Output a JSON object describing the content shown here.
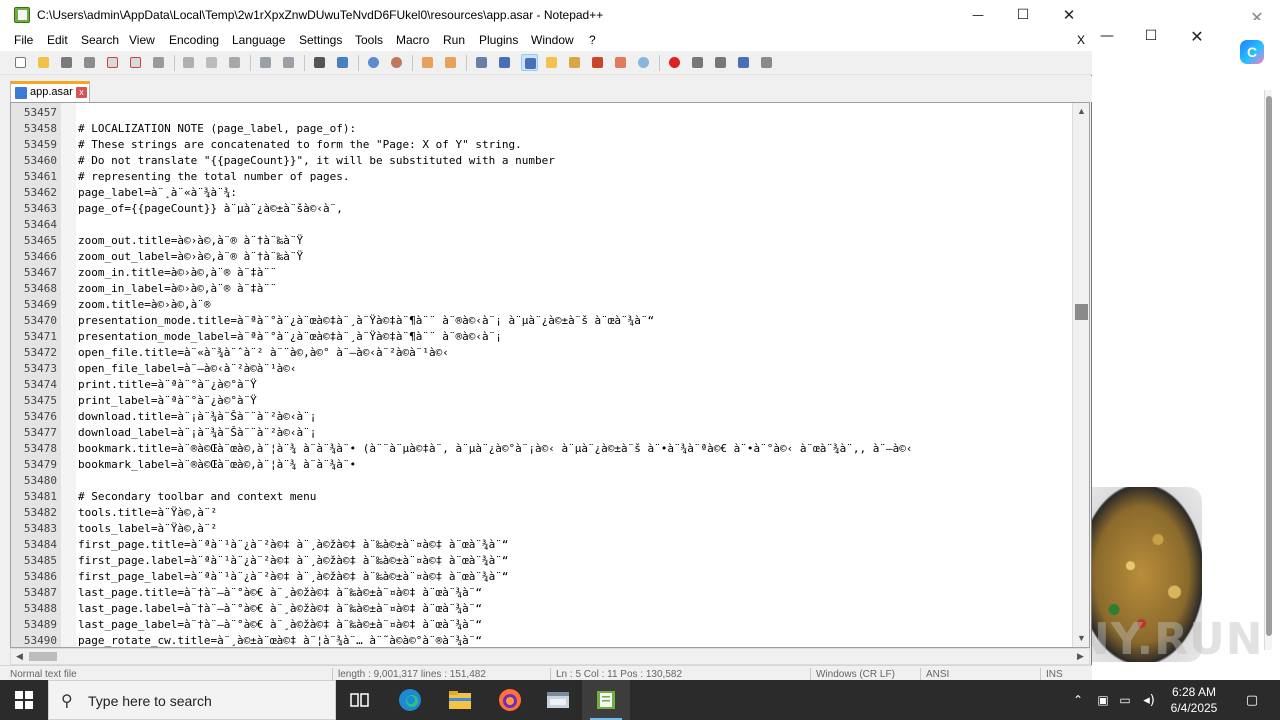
{
  "window": {
    "title": "C:\\Users\\admin\\AppData\\Local\\Temp\\2w1rXpxZnwDUwuTeNvdD6FUkel0\\resources\\app.asar - Notepad++",
    "minimize": "—",
    "maximize": "☐",
    "close": "✕"
  },
  "menu": {
    "items": [
      "File",
      "Edit",
      "Search",
      "View",
      "Encoding",
      "Language",
      "Settings",
      "Tools",
      "Macro",
      "Run",
      "Plugins",
      "Window",
      "?"
    ],
    "close_doc": "X"
  },
  "tab": {
    "label": "app.asar",
    "close": "x"
  },
  "editor": {
    "lines": [
      {
        "num": "53457",
        "text": ""
      },
      {
        "num": "53458",
        "text": "# LOCALIZATION NOTE (page_label, page_of):"
      },
      {
        "num": "53459",
        "text": "# These strings are concatenated to form the \"Page: X of Y\" string."
      },
      {
        "num": "53460",
        "text": "# Do not translate \"{{pageCount}}\", it will be substituted with a number"
      },
      {
        "num": "53461",
        "text": "# representing the total number of pages."
      },
      {
        "num": "53462",
        "text": "page_label=à¨¸à¨«à¨¾à¨¾:"
      },
      {
        "num": "53463",
        "text": "page_of={{pageCount}} à¨µà¨¿à©±à¨šà©‹à¨,"
      },
      {
        "num": "53464",
        "text": ""
      },
      {
        "num": "53465",
        "text": "zoom_out.title=à©›à©‚à¨® à¨†à¨‰à¨Ÿ"
      },
      {
        "num": "53466",
        "text": "zoom_out_label=à©›à©‚à¨® à¨†à¨‰à¨Ÿ"
      },
      {
        "num": "53467",
        "text": "zoom_in.title=à©›à©‚à¨® à¨‡à¨¨"
      },
      {
        "num": "53468",
        "text": "zoom_in_label=à©›à©‚à¨® à¨‡à¨¨"
      },
      {
        "num": "53469",
        "text": "zoom.title=à©›à©‚à¨®"
      },
      {
        "num": "53470",
        "text": "presentation_mode.title=à¨ªà¨°à¨¿à¨œà©‡à¨¸à¨Ÿà©‡à¨¶à¨¨ à¨®à©‹à¨¡ à¨µà¨¿à©±à¨š à¨œà¨¾à¨“"
      },
      {
        "num": "53471",
        "text": "presentation_mode_label=à¨ªà¨°à¨¿à¨œà©‡à¨¸à¨Ÿà©‡à¨¶à¨¨ à¨®à©‹à¨¡"
      },
      {
        "num": "53472",
        "text": "open_file.title=à¨«à¨¾à¨ˆà¨² à¨¨à©‚à©° à¨–à©‹à¨²à©à¨¹à©‹"
      },
      {
        "num": "53473",
        "text": "open_file_label=à¨–à©‹à¨²à©à¨¹à©‹"
      },
      {
        "num": "53474",
        "text": "print.title=à¨ªà¨°à¨¿à©°à¨Ÿ"
      },
      {
        "num": "53475",
        "text": "print_label=à¨ªà¨°à¨¿à©°à¨Ÿ"
      },
      {
        "num": "53476",
        "text": "download.title=à¨¡à¨¾à¨Šà¨¨à¨²à©‹à¨¡"
      },
      {
        "num": "53477",
        "text": "download_label=à¨¡à¨¾à¨Šà¨¨à¨²à©‹à¨¡"
      },
      {
        "num": "53478",
        "text": "bookmark.title=à¨®à©Œà¨œà©‚à¨¦à¨¾ à¨à¨¾à¨• (à¨¨à¨µà©‡à¨‚ à¨µà¨¿à©°à¨¡à©‹ à¨µà¨¿à©±à¨š à¨•à¨¾à¨ªà©€ à¨•à¨°à©‹ à¨œà¨¾à¨‚, à¨–à©‹"
      },
      {
        "num": "53479",
        "text": "bookmark_label=à¨®à©Œà¨œà©‚à¨¦à¨¾ à¨à¨¾à¨•"
      },
      {
        "num": "53480",
        "text": ""
      },
      {
        "num": "53481",
        "text": "# Secondary toolbar and context menu"
      },
      {
        "num": "53482",
        "text": "tools.title=à¨Ÿà©‚à¨²"
      },
      {
        "num": "53483",
        "text": "tools_label=à¨Ÿà©‚à¨²"
      },
      {
        "num": "53484",
        "text": "first_page.title=à¨ªà¨¹à¨¿à¨²à©‡ à¨¸à©žà©‡ à¨‰à©±à¨¤à©‡ à¨œà¨¾à¨“"
      },
      {
        "num": "53485",
        "text": "first_page.label=à¨ªà¨¹à¨¿à¨²à©‡ à¨¸à©žà©‡ à¨‰à©±à¨¤à©‡ à¨œà¨¾à¨“"
      },
      {
        "num": "53486",
        "text": "first_page_label=à¨ªà¨¹à¨¿à¨²à©‡ à¨¸à©žà©‡ à¨‰à©±à¨¤à©‡ à¨œà¨¾à¨“"
      },
      {
        "num": "53487",
        "text": "last_page.title=à¨†à¨–à¨°à©€ à¨¸à©žà©‡ à¨‰à©±à¨¤à©‡ à¨œà¨¾à¨“"
      },
      {
        "num": "53488",
        "text": "last_page.label=à¨†à¨–à¨°à©€ à¨¸à©žà©‡ à¨‰à©±à¨¤à©‡ à¨œà¨¾à¨“"
      },
      {
        "num": "53489",
        "text": "last_page_label=à¨†à¨–à¨°à©€ à¨¸à©žà©‡ à¨‰à©±à¨¤à©‡ à¨œà¨¾à¨“"
      },
      {
        "num": "53490",
        "text": "page_rotate_cw.title=à¨¸à©±à¨œà©‡ à¨¦à¨¾à¨… à¨˜à©à©°à¨®à¨¾à¨“"
      }
    ],
    "scroll_position": 0.37
  },
  "statusbar": {
    "file_type": "Normal text file",
    "length_lines": "length : 9,001,317   lines : 151,482",
    "position": "Ln : 5   Col : 11   Pos : 130,582",
    "eol": "Windows (CR LF)",
    "encoding": "ANSI",
    "insert": "INS"
  },
  "taskbar": {
    "search_placeholder": "Type here to search",
    "time": "6:28 AM",
    "date": "6/4/2025"
  },
  "background_window": {
    "watermark": "ANY.RUN"
  },
  "colors": {
    "tab_accent": "#f5a623",
    "taskbar": "#2b2b2b",
    "gutter": "#e4e4e4"
  }
}
